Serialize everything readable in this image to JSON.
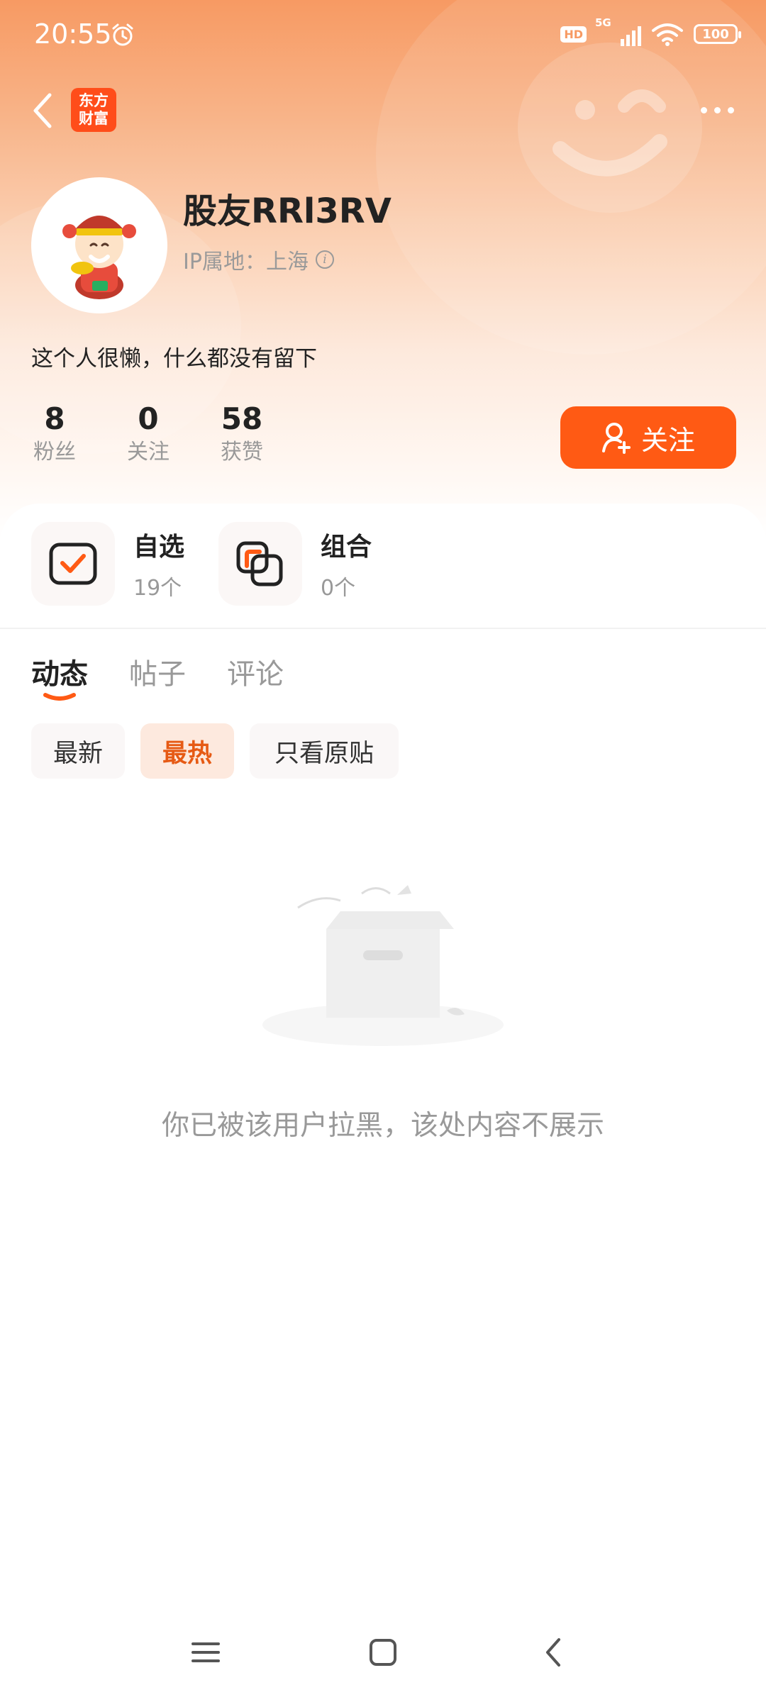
{
  "status_bar": {
    "time": "20:55",
    "hd": "HD",
    "network": "5G",
    "battery": "100"
  },
  "header": {
    "logo_line1": "东方",
    "logo_line2": "财富"
  },
  "profile": {
    "username": "股友RRl3RV",
    "ip_label": "IP属地：",
    "ip_location": "上海",
    "bio": "这个人很懒，什么都没有留下",
    "stats": [
      {
        "value": "8",
        "label": "粉丝"
      },
      {
        "value": "0",
        "label": "关注"
      },
      {
        "value": "58",
        "label": "获赞"
      }
    ],
    "follow_label": "关注"
  },
  "portfolio": {
    "items": [
      {
        "title": "自选",
        "count": "19个"
      },
      {
        "title": "组合",
        "count": "0个"
      }
    ]
  },
  "tabs": [
    {
      "label": "动态",
      "active": true
    },
    {
      "label": "帖子",
      "active": false
    },
    {
      "label": "评论",
      "active": false
    }
  ],
  "filters": [
    {
      "label": "最新",
      "active": false
    },
    {
      "label": "最热",
      "active": true
    },
    {
      "label": "只看原贴",
      "active": false
    }
  ],
  "empty_state": {
    "message": "你已被该用户拉黑，该处内容不展示"
  },
  "colors": {
    "accent": "#ff5a14",
    "header_gradient_top": "#f79a63"
  }
}
